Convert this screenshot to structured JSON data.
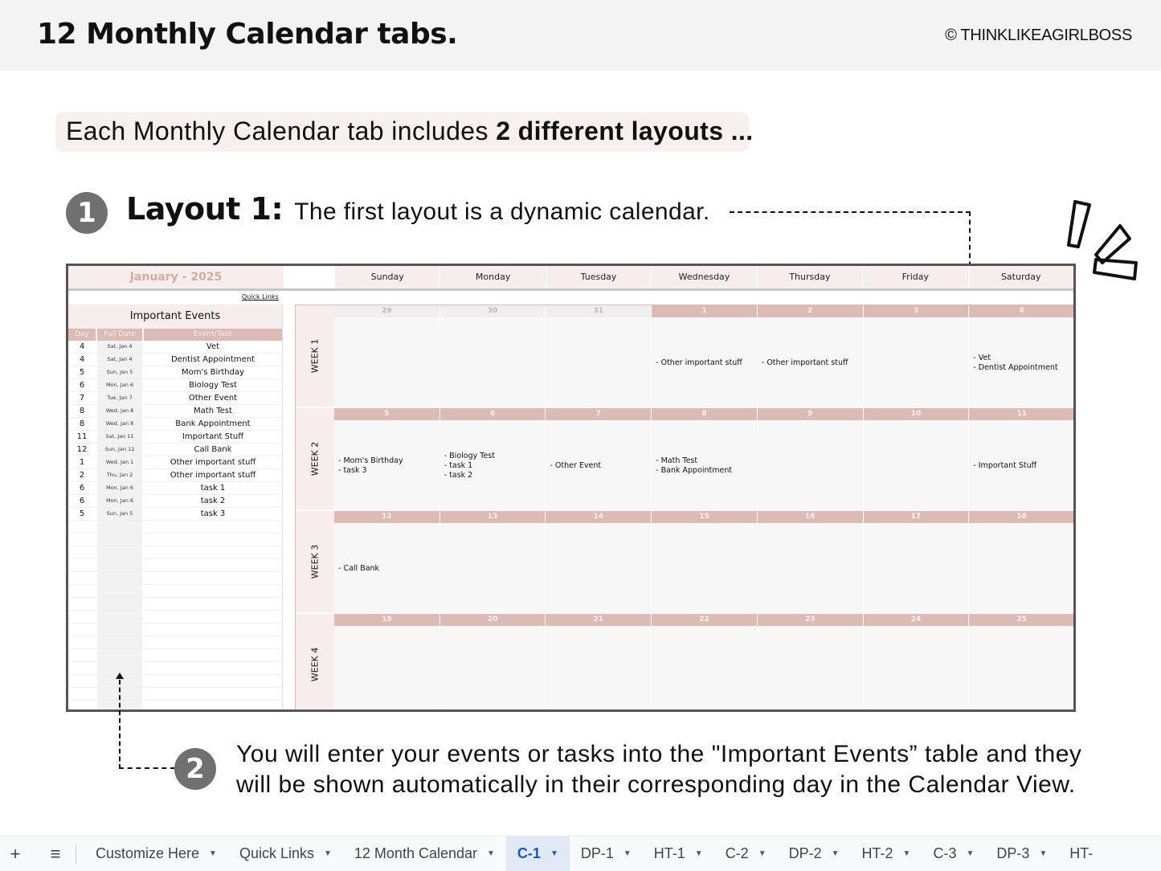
{
  "header": {
    "title": "12 Monthly Calendar tabs.",
    "copyright": "© THINKLIKEAGIRLBOSS"
  },
  "intro": {
    "text": "Each Monthly Calendar tab includes ",
    "bold": "2 different layouts ..."
  },
  "layout1": {
    "badge": "1",
    "label": "Layout 1:",
    "description": "The first layout is a dynamic calendar."
  },
  "note2": {
    "badge": "2",
    "line1": "You will enter your events or tasks into the \"Important Events” table and they",
    "line2": "will be shown automatically in their corresponding day in the Calendar View."
  },
  "calendar": {
    "month_title": "January - 2025",
    "quick_links": "Quick Links",
    "weekdays": [
      "Sunday",
      "Monday",
      "Tuesday",
      "Wednesday",
      "Thursday",
      "Friday",
      "Saturday"
    ],
    "events_table": {
      "title": "Important Events",
      "columns": [
        "Day",
        "Full Date",
        "Event/Task"
      ],
      "rows": [
        {
          "day": "4",
          "date": "Sat, Jan 4",
          "event": "Vet"
        },
        {
          "day": "4",
          "date": "Sat, Jan 4",
          "event": "Dentist Appointment"
        },
        {
          "day": "5",
          "date": "Sun, Jan 5",
          "event": "Mom's Birthday"
        },
        {
          "day": "6",
          "date": "Mon, Jan 6",
          "event": "Biology Test"
        },
        {
          "day": "7",
          "date": "Tue, Jan 7",
          "event": "Other Event"
        },
        {
          "day": "8",
          "date": "Wed, Jan 8",
          "event": "Math Test"
        },
        {
          "day": "8",
          "date": "Wed, Jan 8",
          "event": "Bank Appointment"
        },
        {
          "day": "11",
          "date": "Sat, Jan 11",
          "event": "Important Stuff"
        },
        {
          "day": "12",
          "date": "Sun, Jan 12",
          "event": "Call Bank"
        },
        {
          "day": "1",
          "date": "Wed, Jan 1",
          "event": "Other important stuff"
        },
        {
          "day": "2",
          "date": "Thu, Jan 2",
          "event": "Other important stuff"
        },
        {
          "day": "6",
          "date": "Mon, Jan 6",
          "event": "task 1"
        },
        {
          "day": "6",
          "date": "Mon, Jan 6",
          "event": "task 2"
        },
        {
          "day": "5",
          "date": "Sun, Jan 5",
          "event": "task 3"
        }
      ],
      "empty_rows": 15
    },
    "weeks": [
      {
        "label": "WEEK 1",
        "days": [
          {
            "num": "29",
            "muted": true,
            "events": []
          },
          {
            "num": "30",
            "muted": true,
            "events": []
          },
          {
            "num": "31",
            "muted": true,
            "events": []
          },
          {
            "num": "1",
            "events": [
              "- Other important stuff"
            ]
          },
          {
            "num": "2",
            "events": [
              "- Other important stuff"
            ]
          },
          {
            "num": "3",
            "events": []
          },
          {
            "num": "4",
            "events": [
              "- Vet",
              "- Dentist Appointment"
            ]
          }
        ]
      },
      {
        "label": "WEEK 2",
        "days": [
          {
            "num": "5",
            "events": [
              "- Mom's Birthday",
              "- task 3"
            ]
          },
          {
            "num": "6",
            "events": [
              "- Biology Test",
              "- task 1",
              "- task 2"
            ]
          },
          {
            "num": "7",
            "events": [
              "- Other Event"
            ]
          },
          {
            "num": "8",
            "events": [
              "- Math Test",
              "- Bank Appointment"
            ]
          },
          {
            "num": "9",
            "events": []
          },
          {
            "num": "10",
            "events": []
          },
          {
            "num": "11",
            "events": [
              "- Important Stuff"
            ]
          }
        ]
      },
      {
        "label": "WEEK 3",
        "days": [
          {
            "num": "12",
            "events": [
              "- Call Bank"
            ]
          },
          {
            "num": "13",
            "events": []
          },
          {
            "num": "14",
            "events": []
          },
          {
            "num": "15",
            "events": []
          },
          {
            "num": "16",
            "events": []
          },
          {
            "num": "17",
            "events": []
          },
          {
            "num": "18",
            "events": []
          }
        ]
      },
      {
        "label": "WEEK 4",
        "days": [
          {
            "num": "19",
            "events": []
          },
          {
            "num": "20",
            "events": []
          },
          {
            "num": "21",
            "events": []
          },
          {
            "num": "22",
            "events": []
          },
          {
            "num": "23",
            "events": []
          },
          {
            "num": "24",
            "events": []
          },
          {
            "num": "25",
            "events": []
          }
        ]
      }
    ]
  },
  "sheet_tabs": {
    "add_icon": "plus-icon",
    "menu_icon": "hamburger-menu-icon",
    "active": "C-1",
    "tabs": [
      "Customize Here",
      "Quick Links",
      "12 Month Calendar",
      "C-1",
      "DP-1",
      "HT-1",
      "C-2",
      "DP-2",
      "HT-2",
      "C-3",
      "DP-3",
      "HT-"
    ]
  },
  "colors": {
    "accent_rose": "#dcbab6",
    "rose_light": "#f5eeed",
    "badge_gray": "#707070",
    "active_tab": "#1a56c4"
  }
}
